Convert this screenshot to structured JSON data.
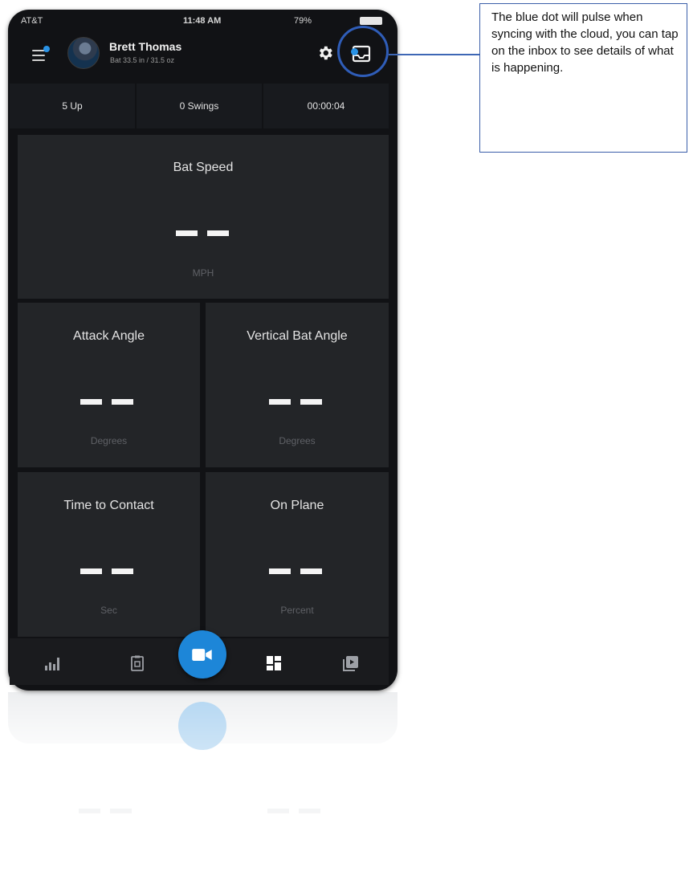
{
  "status_bar": {
    "carrier": "AT&T",
    "time": "11:48 AM",
    "battery": "79%"
  },
  "header": {
    "user_name": "Brett Thomas",
    "bat_info": "Bat 33.5 in / 31.5 oz"
  },
  "stats": {
    "up": "5 Up",
    "swings": "0 Swings",
    "timer": "00:00:04"
  },
  "metrics": {
    "bat_speed": {
      "title": "Bat Speed",
      "unit": "MPH"
    },
    "attack_angle": {
      "title": "Attack Angle",
      "unit": "Degrees"
    },
    "vertical_bat_angle": {
      "title": "Vertical Bat Angle",
      "unit": "Degrees"
    },
    "time_to_contact": {
      "title": "Time to Contact",
      "unit": "Sec"
    },
    "on_plane": {
      "title": "On Plane",
      "unit": "Percent"
    }
  },
  "tabs": [
    "stats-icon",
    "clipboard-icon",
    "record-video-icon",
    "dashboard-grid-icon",
    "video-library-icon"
  ],
  "annotation": {
    "text": "The blue dot will pulse when syncing with the cloud, you can tap on the inbox to see details of what is happening."
  },
  "colors": {
    "accent_blue": "#1d86d8",
    "callout_border": "#2f5db8",
    "tile_bg": "#232528",
    "screen_bg": "#111215"
  }
}
